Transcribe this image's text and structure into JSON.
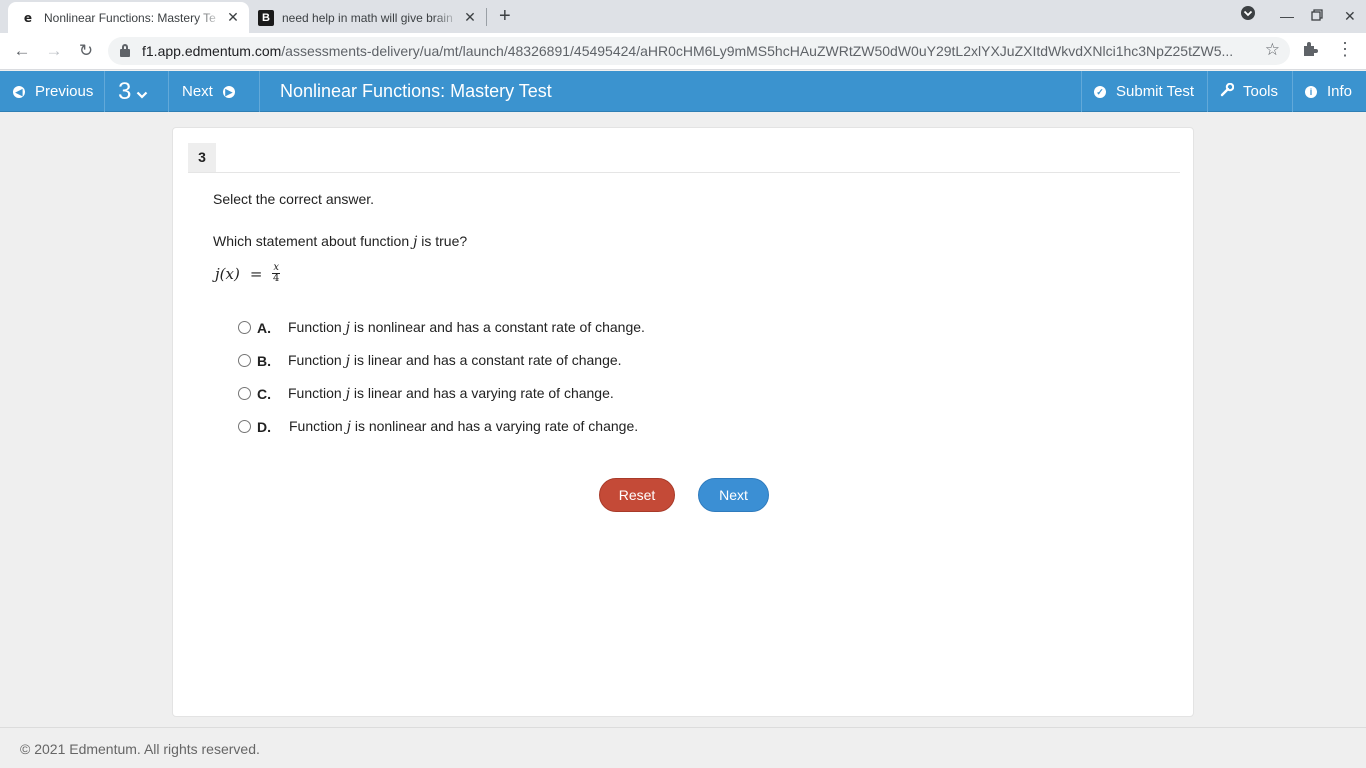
{
  "browser": {
    "tabs": [
      {
        "title": "Nonlinear Functions: Mastery Te",
        "favicon": "e",
        "active": true
      },
      {
        "title": "need help in math will give brain",
        "favicon": "B",
        "active": false
      }
    ],
    "url_host": "f1.app.edmentum.com",
    "url_path": "/assessments-delivery/ua/mt/launch/48326891/45495424/aHR0cHM6Ly9mMS5hcHAuZWRtZW50dW0uY29tL2xlYXJuZXItdWkvdXNlci1hc3NpZ25tZW5..."
  },
  "header": {
    "previous_label": "Previous",
    "question_number": "3",
    "next_label": "Next",
    "title": "Nonlinear Functions: Mastery Test",
    "submit_label": "Submit Test",
    "tools_label": "Tools",
    "info_label": "Info",
    "accent_color": "#3b93cf"
  },
  "question": {
    "number": "3",
    "instruction": "Select the correct answer.",
    "stem_before": "Which statement about function ",
    "stem_var": "j",
    "stem_after": " is true?",
    "equation": {
      "lhs": "j(x)",
      "eq": "=",
      "numerator": "x",
      "denominator": "4"
    },
    "options": [
      {
        "letter": "A.",
        "before": "Function ",
        "var": "j",
        "after": " is nonlinear and has a constant rate of change."
      },
      {
        "letter": "B.",
        "before": "Function ",
        "var": "j",
        "after": " is linear and has a constant rate of change."
      },
      {
        "letter": "C.",
        "before": "Function ",
        "var": "j",
        "after": " is linear and has a varying rate of change."
      },
      {
        "letter": "D.",
        "before": "Function ",
        "var": "j",
        "after": " is nonlinear and has a varying rate of change."
      }
    ]
  },
  "actions": {
    "reset_label": "Reset",
    "next_label": "Next"
  },
  "footer": {
    "copyright": "© 2021 Edmentum. All rights reserved."
  }
}
